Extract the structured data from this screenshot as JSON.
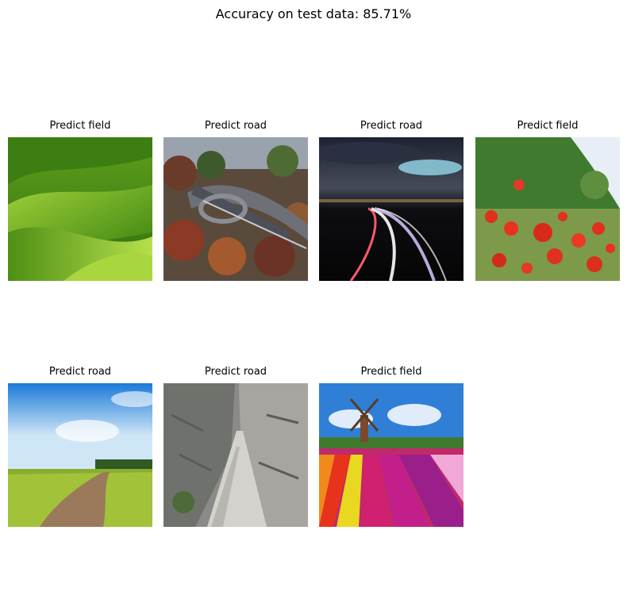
{
  "title": "Accuracy on test data: 85.71%",
  "predictions": [
    {
      "label": "Predict field",
      "scene": "green rolling hills"
    },
    {
      "label": "Predict road",
      "scene": "aerial highway interchange with autumn trees"
    },
    {
      "label": "Predict road",
      "scene": "night highway light trails"
    },
    {
      "label": "Predict field",
      "scene": "red poppy field"
    },
    {
      "label": "Predict road",
      "scene": "dirt path through green field"
    },
    {
      "label": "Predict road",
      "scene": "narrow road along rocky cliff"
    },
    {
      "label": "Predict field",
      "scene": "windmill with tulip stripes"
    }
  ]
}
